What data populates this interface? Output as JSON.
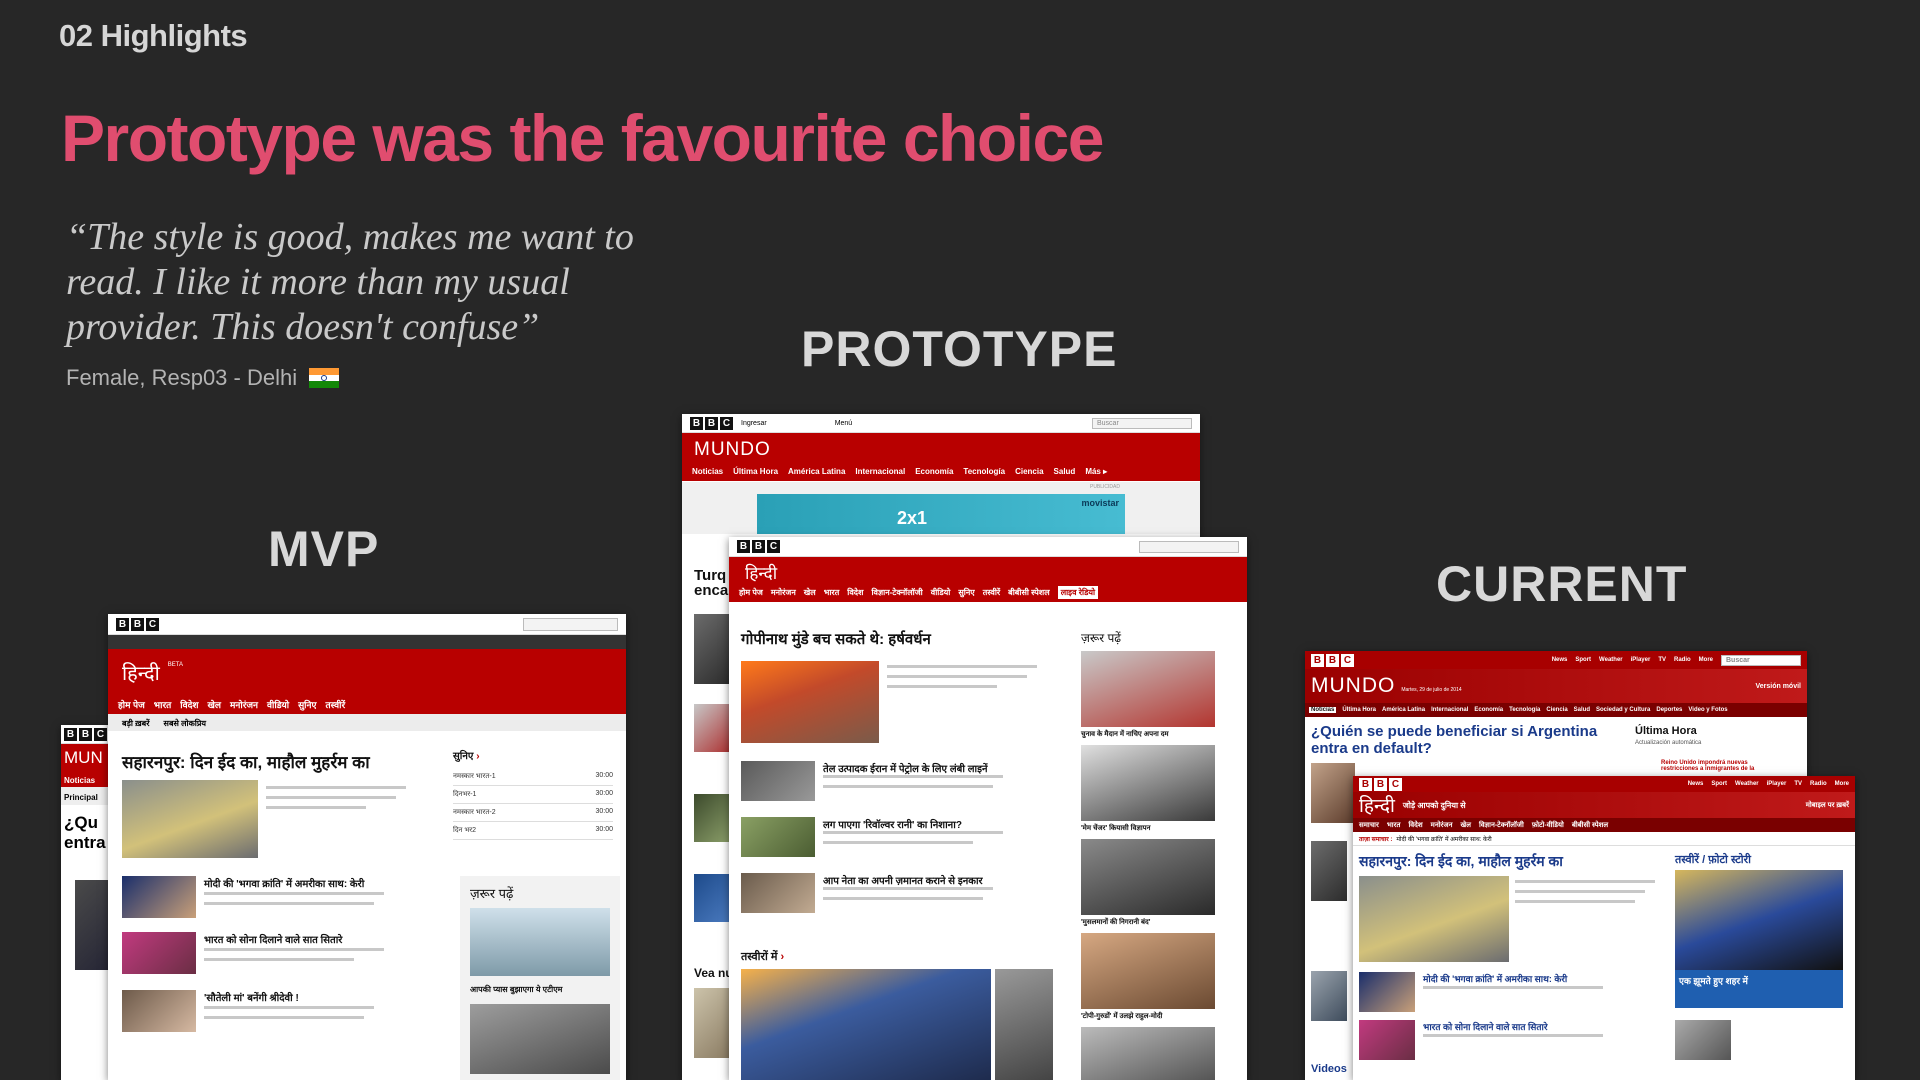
{
  "section_label": "02 Highlights",
  "headline": "Prototype was the favourite choice",
  "quote": "“The style is good, makes me want to read.  I like it more than my usual provider.  This doesn't confuse”",
  "attribution": "Female, Resp03 - Delhi",
  "columns": {
    "mvp": "MVP",
    "prototype": "PROTOTYPE",
    "current": "CURRENT"
  },
  "colors": {
    "background": "#272727",
    "headline": "#e04d6f",
    "bbc_red": "#b80000"
  },
  "icons": [
    "india-flag-icon",
    "search-icon",
    "arrow-right-icon"
  ],
  "mvp_screen": {
    "brand": "हिन्दी",
    "beta": "BETA",
    "nav": [
      "होम पेज",
      "भारत",
      "विदेश",
      "खेल",
      "मनोरंजन",
      "वीडियो",
      "सुनिए",
      "तस्वीरें"
    ],
    "tabs": [
      "बड़ी ख़बरें",
      "सबसे लोकप्रिय"
    ],
    "lead_headline": "सहारनपुर: दिन ईद का, माहौल मुहर्रम का",
    "stories": [
      "मोदी की 'भगवा क्रांति' में अमरीका साथ: केरी",
      "भारत को सोना दिलाने वाले सात सितारे",
      "'सौतेली मां' बनेंगी श्रीदेवी !"
    ],
    "listen_title": "सुनिए",
    "listen_items": [
      {
        "name": "नमस्कार भारत-1",
        "time": "30:00"
      },
      {
        "name": "दिनभर-1",
        "time": "30:00"
      },
      {
        "name": "नमस्कार भारत-2",
        "time": "30:00"
      },
      {
        "name": "दिन भर2",
        "time": "30:00"
      }
    ],
    "must_read": "ज़रूर पढ़ें",
    "caption": "आपकी प्यास बुझाएगा ये एटीएम"
  },
  "mvp_behind": {
    "brand": "MUN",
    "headline": "¿Qu entra",
    "nav": "Noticias",
    "tab": "Principal"
  },
  "proto_back": {
    "brand": "MUNDO",
    "login": "Ingresar",
    "menu": "Menú",
    "search": "Buscar",
    "nav": [
      "Noticias",
      "Última Hora",
      "América Latina",
      "Internacional",
      "Economía",
      "Tecnología",
      "Ciencia",
      "Salud",
      "Más ▸"
    ],
    "ad_label": "PUBLICIDAD",
    "ad_text": "2x1",
    "ad_brand": "movistar",
    "side_headline": "Turq enca"
  },
  "proto_front": {
    "brand": "हिन्दी",
    "nav": [
      "होम पेज",
      "मनोरंजन",
      "खेल",
      "भारत",
      "विदेश",
      "विज्ञान-टेक्नॉलॉजी",
      "वीडियो",
      "सुनिए",
      "तस्वीरें",
      "बीबीसी स्पेशल"
    ],
    "live": "लाइव रेडियो",
    "lead_headline": "गोपीनाथ मुंडे बच सकते थे: हर्षवर्धन",
    "stories": [
      "तेल उत्पादक ईरान में पेट्रोल के लिए लंबी लाइनें",
      "लग पाएगा 'रिवॉल्वर रानी' का निशाना?",
      "आप नेता का अपनी ज़मानत कराने से इनकार"
    ],
    "must_read": "ज़रूर पढ़ें",
    "captions": [
      "चुनाव के मैदान में नाचिए अपना दम",
      "'मेम चेंजर' कियासी विज्ञापन",
      "'मुसलमानों की निगरानी बंद'",
      "'टोपी-गुरुडों' में उलझे राहुल-मोदी"
    ],
    "photos_label": "तस्वीरों में",
    "side_label": "Vea nu"
  },
  "current_back": {
    "brand": "MUNDO",
    "date": "Martes, 29 de julio de 2014",
    "mobile": "Versión móvil",
    "top_links": [
      "News",
      "Sport",
      "Weather",
      "iPlayer",
      "TV",
      "Radio",
      "More"
    ],
    "search": "Buscar",
    "nav": [
      "Noticias",
      "Última Hora",
      "América Latina",
      "Internacional",
      "Economía",
      "Tecnología",
      "Ciencia",
      "Salud",
      "Sociedad y Cultura",
      "Deportes",
      "Video y Fotos"
    ],
    "headline": "¿Quién se puede beneficiar si Argentina entra en default?",
    "side_title": "Última Hora",
    "side_sub": "Actualización automática",
    "side_story": "Reino Unido impondrá nuevas restricciones a inmigrantes de la",
    "videos": "Videos"
  },
  "current_front": {
    "brand": "हिन्दी",
    "tagline": "जोड़े आपको दुनिया से",
    "mobile": "मोबाइल पर ख़बरें",
    "nav": [
      "समाचार",
      "भारत",
      "विदेश",
      "मनोरंजन",
      "खेल",
      "विज्ञान-टेक्नॉलॉजी",
      "फ़ोटो-वीडियो",
      "बीबीसी स्पेशल"
    ],
    "ticker_label": "ताज़ा समाचार :",
    "ticker": "मोदी की 'भगवा क्रांति' में अमरीका साथ: केरी",
    "lead_headline": "सहारनपुर: दिन ईद का, माहौल मुहर्रम का",
    "stories": [
      "मोदी की 'भगवा क्रांति' में अमरीका साथ: केरी",
      "भारत को सोना दिलाने वाले सात सितारे"
    ],
    "gallery_title": "तस्वीरें / फ़ोटो स्टोरी",
    "gallery_caption": "एक झूमते हुए शहर में"
  }
}
